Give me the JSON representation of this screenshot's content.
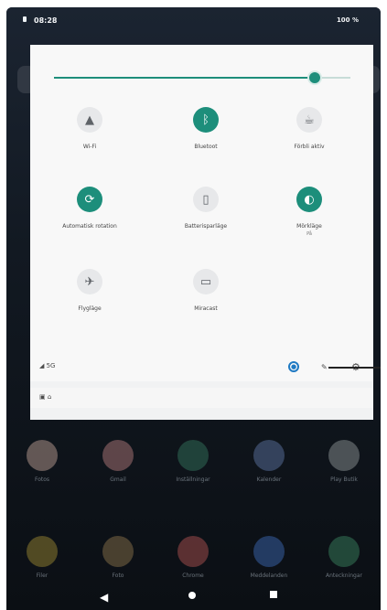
{
  "status_bar": {
    "time": "08:28",
    "right_text": "100 %"
  },
  "quick_settings": {
    "tiles": [
      {
        "label": "Wi-Fi",
        "icon": "wifi-icon",
        "on": false
      },
      {
        "label": "Bluetoot",
        "icon": "bluetooth-icon",
        "on": true
      },
      {
        "label": "Förbli aktiv",
        "icon": "stay-awake-icon",
        "on": false
      },
      {
        "label": "Automatisk rotation",
        "icon": "auto-rotate-icon",
        "on": true
      },
      {
        "label": "Batterisparläge",
        "icon": "battery-saver-icon",
        "on": false
      },
      {
        "label": "Mörkläge",
        "icon": "dark-mode-icon",
        "on": true,
        "sub": "På"
      },
      {
        "label": "Flygläge",
        "icon": "airplane-icon",
        "on": false
      },
      {
        "label": "Miracast",
        "icon": "cast-icon",
        "on": false
      }
    ],
    "bottom": {
      "left_text": "◢ 5G",
      "user": "user-icon",
      "edit": "edit-icon",
      "settings": "settings-icon"
    },
    "notification_strip": "▣  ⌂"
  },
  "home_apps": [
    {
      "label": "Fotos",
      "icon": "photos-icon"
    },
    {
      "label": "Gmail",
      "icon": "gmail-icon"
    },
    {
      "label": "Inställningar",
      "icon": "settings-icon"
    },
    {
      "label": "Kalender",
      "icon": "calendar-icon"
    },
    {
      "label": "Play Butik",
      "icon": "play-store-icon"
    },
    {
      "label": "Filer",
      "icon": "files-icon"
    },
    {
      "label": "Foto",
      "icon": "gallery-icon"
    },
    {
      "label": "Chrome",
      "icon": "chrome-icon"
    },
    {
      "label": "Meddelanden",
      "icon": "messages-icon"
    },
    {
      "label": "Anteckningar",
      "icon": "notes-icon"
    }
  ],
  "navigation": {
    "back": "back-icon",
    "home": "home-icon",
    "recents": "recents-icon"
  },
  "brightness": {
    "value": 0.88
  }
}
